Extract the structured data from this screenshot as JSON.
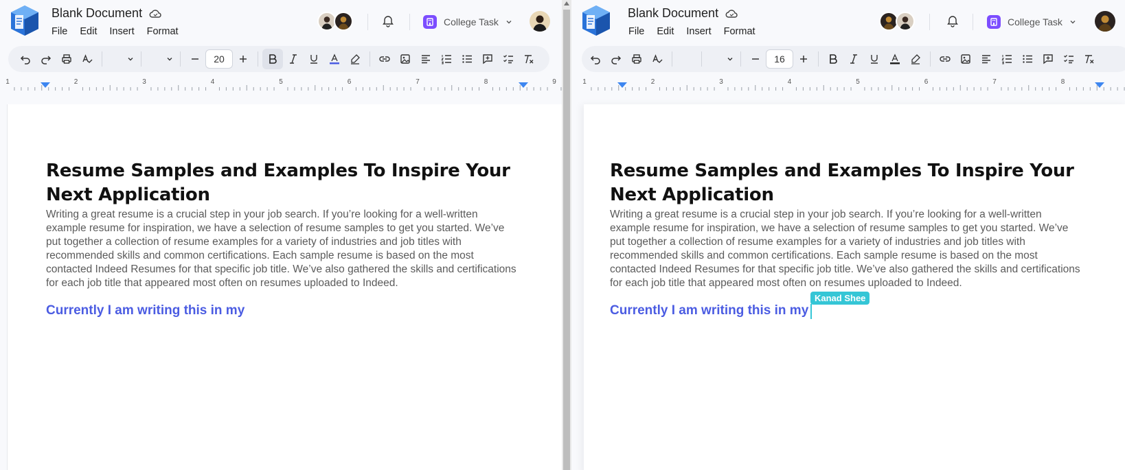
{
  "document": {
    "title": "Blank Document",
    "menu": [
      "File",
      "Edit",
      "Insert",
      "Format"
    ],
    "heading": "Resume Samples and Examples To Inspire Your Next Application",
    "paragraph": "Writing a great resume is a crucial step in your job search. If you’re looking for a well-written example resume for inspiration, we have a selection of resume samples to get you started. We’ve put together a collection of resume examples for a variety of industries and job titles with recommended skills and common certifications. Each sample resume is based on the most contacted Indeed Resumes for that specific job title. We’ve also gathered the skills and certifications for each job title that appeared most often on resumes uploaded to Indeed.",
    "typed_line": "Currently I am writing this in my"
  },
  "workspace": {
    "name": "College Task"
  },
  "left_editor": {
    "font_size": "20",
    "bold_active": true
  },
  "right_editor": {
    "font_size": "16",
    "collaborator_cursor": "Kanad Shee"
  },
  "ruler_labels_left": [
    "1",
    "2",
    "3",
    "4",
    "5",
    "6",
    "7",
    "8",
    "9"
  ],
  "ruler_labels_right": [
    "1",
    "2",
    "3",
    "4",
    "5",
    "6",
    "7",
    "8"
  ],
  "colors": {
    "accent_blue": "#4b5ce2",
    "workspace_purple": "#7c4dff",
    "cursor_cyan": "#35c6d6",
    "ruler_marker": "#3d86f0"
  },
  "icons": [
    "app-logo-icon",
    "cloud-icon",
    "bell-icon",
    "workspace-icon",
    "chevron-down-icon",
    "undo-icon",
    "redo-icon",
    "print-icon",
    "spellcheck-icon",
    "minus-icon",
    "plus-icon",
    "bold-icon",
    "italic-icon",
    "underline-icon",
    "text-color-icon",
    "highlight-icon",
    "link-icon",
    "image-icon",
    "align-left-icon",
    "numbered-list-icon",
    "bullet-list-icon",
    "comment-icon",
    "checklist-icon",
    "clear-format-icon"
  ]
}
